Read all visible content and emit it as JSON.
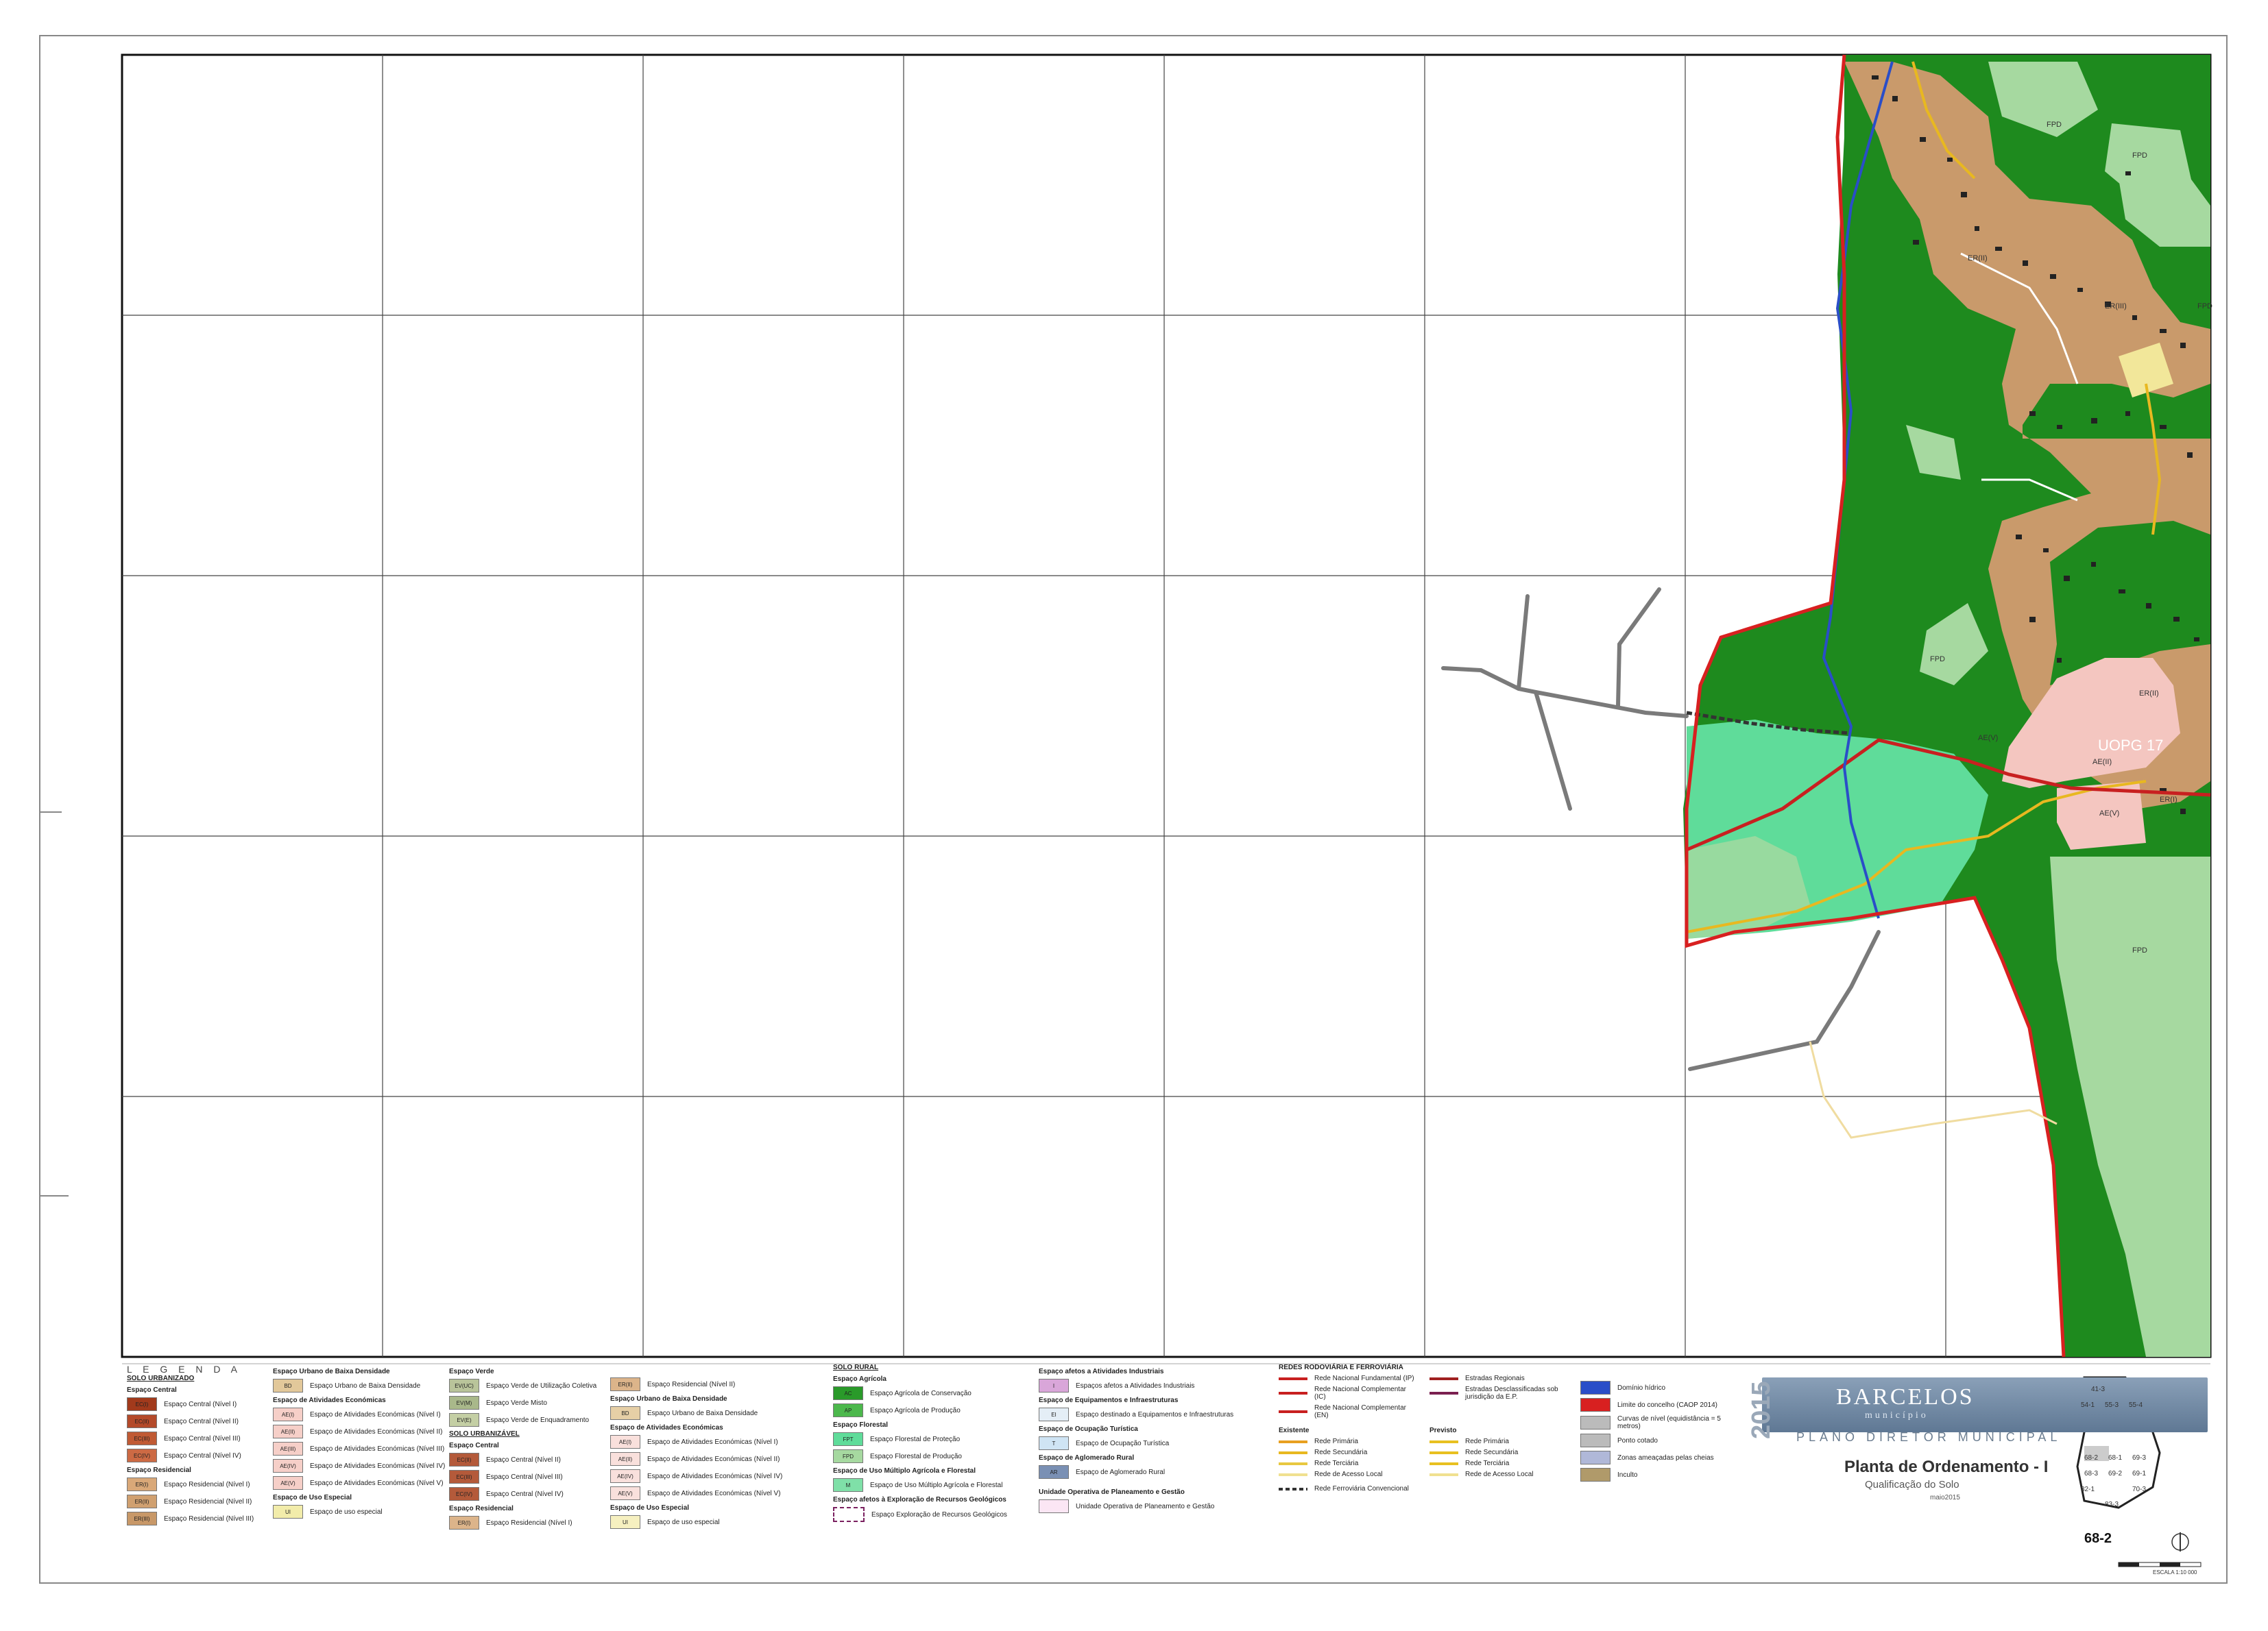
{
  "title_block": {
    "municipality": "BARCELOS",
    "municipality_sub": "município",
    "year": "2015",
    "plan": "PLANO DIRETOR MUNICIPAL",
    "map_title": "Planta de Ordenamento - I",
    "map_subtitle": "Qualificação do Solo",
    "date": "maio2015",
    "sheet": "68-2",
    "scale": "ESCALA 1:10 000"
  },
  "key_map": {
    "cells": [
      "41-3",
      "54-1",
      "55-3",
      "55-4",
      "68-2",
      "68-1",
      "68-3",
      "69-2",
      "69-1",
      "69-3",
      "70-3",
      "82-1",
      "83-3"
    ]
  },
  "map": {
    "labels": [
      "FPD",
      "FPD",
      "FPD",
      "FPD",
      "ER(II)",
      "ER(III)",
      "AE(II)",
      "AE(V)",
      "AE(V)",
      "ER(II)",
      "UOPG 17",
      "ER(I)",
      "FPD"
    ],
    "colors": {
      "agri_conservation": "#1e8a1e",
      "forest_protection": "#5fdc9a",
      "forest_production": "#a6d9a0",
      "residential": "#c99a6b",
      "economic": "#f4c6c0",
      "equipment": "#f2e79a",
      "boundary": "#d82020",
      "river": "#2a4ec8",
      "road_gray": "#7a7a7a",
      "road_yellow": "#e8b820"
    }
  },
  "legend": {
    "heading": "L E G E N D A",
    "col1": {
      "title": "SOLO URBANIZADO",
      "g1": "Espaço Central",
      "items1": [
        {
          "code": "EC(I)",
          "label": "Espaço Central (Nível I)",
          "color": "#a23a1c"
        },
        {
          "code": "EC(II)",
          "label": "Espaço Central (Nível II)",
          "color": "#b44a2a"
        },
        {
          "code": "EC(III)",
          "label": "Espaço Central (Nível III)",
          "color": "#c05a34"
        },
        {
          "code": "EC(IV)",
          "label": "Espaço Central (Nível IV)",
          "color": "#cc6a44"
        }
      ],
      "g2": "Espaço Residencial",
      "items2": [
        {
          "code": "ER(I)",
          "label": "Espaço Residencial (Nível I)",
          "color": "#d9a878"
        },
        {
          "code": "ER(II)",
          "label": "Espaço Residencial (Nível II)",
          "color": "#d0a070"
        },
        {
          "code": "ER(III)",
          "label": "Espaço Residencial (Nível III)",
          "color": "#c89868"
        }
      ]
    },
    "col2": {
      "g1": "Espaço Urbano de Baixa Densidade",
      "items1": [
        {
          "code": "BD",
          "label": "Espaço Urbano de Baixa Densidade",
          "color": "#e2c89a"
        }
      ],
      "g2": "Espaço de Atividades Económicas",
      "items2": [
        {
          "code": "AE(I)",
          "label": "Espaço de Atividades Económicas (Nível I)",
          "color": "#f6cfc8"
        },
        {
          "code": "AE(II)",
          "label": "Espaço de Atividades Económicas (Nível II)",
          "color": "#f6cfc8"
        },
        {
          "code": "AE(III)",
          "label": "Espaço de Atividades Económicas (Nível III)",
          "color": "#f6cfc8"
        },
        {
          "code": "AE(IV)",
          "label": "Espaço de Atividades Económicas (Nível IV)",
          "color": "#f6cfc8"
        },
        {
          "code": "AE(V)",
          "label": "Espaço de Atividades Económicas (Nível V)",
          "color": "#f6cfc8"
        }
      ],
      "g3": "Espaço de Uso Especial",
      "items3": [
        {
          "code": "UI",
          "label": "Espaço de uso especial",
          "color": "#f2ecaa"
        }
      ]
    },
    "col3": {
      "g1": "Espaço Verde",
      "items1": [
        {
          "code": "EV(UC)",
          "label": "Espaço Verde de Utilização Coletiva",
          "color": "#b9c49a"
        },
        {
          "code": "EV(M)",
          "label": "Espaço Verde Misto",
          "color": "#a9b88a"
        },
        {
          "code": "EV(E)",
          "label": "Espaço Verde de Enquadramento",
          "color": "#c4cfa4"
        }
      ],
      "title2": "SOLO URBANIZÁVEL",
      "g2": "Espaço Central",
      "items2": [
        {
          "code": "EC(II)",
          "label": "Espaço Central (Nível II)",
          "color": "#b45a3a"
        },
        {
          "code": "EC(III)",
          "label": "Espaço Central (Nível III)",
          "color": "#b45a3a"
        },
        {
          "code": "EC(IV)",
          "label": "Espaço Central (Nível IV)",
          "color": "#b45a3a"
        }
      ],
      "g3": "Espaço Residencial",
      "items3": [
        {
          "code": "ER(I)",
          "label": "Espaço Residencial (Nível I)",
          "color": "#dcb48a"
        }
      ]
    },
    "col4": {
      "items1": [
        {
          "code": "ER(II)",
          "label": "Espaço Residencial (Nível II)",
          "color": "#dcb48a"
        }
      ],
      "g2": "Espaço Urbano de Baixa Densidade",
      "items2": [
        {
          "code": "BD",
          "label": "Espaço Urbano de Baixa Densidade",
          "color": "#e6cfa6"
        }
      ],
      "g3": "Espaço de Atividades Económicas",
      "items3": [
        {
          "code": "AE(I)",
          "label": "Espaço de Atividades Económicas (Nível I)",
          "color": "#f9e0dc"
        },
        {
          "code": "AE(II)",
          "label": "Espaço de Atividades Económicas (Nível II)",
          "color": "#f9e0dc"
        },
        {
          "code": "AE(IV)",
          "label": "Espaço de Atividades Económicas (Nível IV)",
          "color": "#f9e0dc"
        },
        {
          "code": "AE(V)",
          "label": "Espaço de Atividades Económicas (Nível V)",
          "color": "#f9e0dc"
        }
      ],
      "g4": "Espaço de Uso Especial",
      "items4": [
        {
          "code": "UI",
          "label": "Espaço de uso especial",
          "color": "#f6f0c0"
        }
      ]
    },
    "col5": {
      "title": "SOLO RURAL",
      "g1": "Espaço Agrícola",
      "items1": [
        {
          "code": "AC",
          "label": "Espaço Agrícola de Conservação",
          "color": "#2a9a2a"
        },
        {
          "code": "AP",
          "label": "Espaço Agrícola de Produção",
          "color": "#4cb84c"
        }
      ],
      "g2": "Espaço Florestal",
      "items2": [
        {
          "code": "FPT",
          "label": "Espaço Florestal de Proteção",
          "color": "#5fdc9a"
        },
        {
          "code": "FPD",
          "label": "Espaço Florestal de Produção",
          "color": "#a6d9a0"
        }
      ],
      "g3": "Espaço de Uso Múltiplo Agrícola e Florestal",
      "items3": [
        {
          "code": "M",
          "label": "Espaço de Uso Múltiplo Agrícola e Florestal",
          "color": "#7fe0a8"
        }
      ],
      "g4": "Espaço afetos à Exploração de Recursos Geológicos",
      "items4": [
        {
          "code": "",
          "label": "Espaço Exploração de Recursos Geológicos",
          "color": "#ffffff"
        }
      ]
    },
    "col6": {
      "g1": "Espaço afetos a Atividades Industriais",
      "items1": [
        {
          "code": "I",
          "label": "Espaços afetos a Atividades Industriais",
          "color": "#d9a6d9"
        }
      ],
      "g2": "Espaço de Equipamentos e Infraestruturas",
      "items2": [
        {
          "code": "EI",
          "label": "Espaço destinado a Equipamentos e Infraestruturas",
          "color": "#e4eef6"
        }
      ],
      "g3": "Espaço de Ocupação Turística",
      "items3": [
        {
          "code": "T",
          "label": "Espaço de Ocupação Turística",
          "color": "#cfe4f4"
        }
      ],
      "g4": "Espaço de Aglomerado Rural",
      "items4": [
        {
          "code": "AR",
          "label": "Espaço de Aglomerado Rural",
          "color": "#7a90b4"
        }
      ],
      "g5": "Unidade Operativa de Planeamento e Gestão",
      "items5": [
        {
          "code": "",
          "label": "Unidade Operativa de Planeamento e Gestão",
          "color": "#fbe6f4"
        }
      ]
    },
    "col7": {
      "title": "REDES RODOVIÁRIA E FERROVIÁRIA",
      "items1": [
        {
          "label": "Rede Nacional Fundamental (IP)",
          "color": "#c82020"
        },
        {
          "label": "Rede Nacional Complementar (IC)",
          "color": "#c82020"
        },
        {
          "label": "Rede Nacional Complementar (EN)",
          "color": "#c82020"
        }
      ],
      "items2": [
        {
          "label": "Estradas Regionais",
          "color": "#a02020"
        },
        {
          "label": "Estradas Desclassificadas sob jurisdição da E.P.",
          "color": "#7a2050"
        }
      ],
      "existing": "Existente",
      "planned": "Previsto",
      "items3": [
        {
          "label": "Rede Primária",
          "color": "#e8a020"
        },
        {
          "label": "Rede Secundária",
          "color": "#e8b820"
        },
        {
          "label": "Rede Terciária",
          "color": "#e8c840"
        },
        {
          "label": "Rede de Acesso Local",
          "color": "#f0e090"
        }
      ],
      "items4": [
        {
          "label": "Rede Primária",
          "color": "#e8c020"
        },
        {
          "label": "Rede Secundária",
          "color": "#e8c020"
        },
        {
          "label": "Rede Terciária",
          "color": "#e8c020"
        },
        {
          "label": "Rede de Acesso Local",
          "color": "#f0e090"
        }
      ],
      "rail": "Rede Ferroviária Convencional"
    },
    "col8": {
      "items": [
        {
          "label": "Domínio hídrico",
          "color": "#2a4ec8"
        },
        {
          "label": "Limite do concelho (CAOP 2014)",
          "color": "#d82020"
        },
        {
          "label": "Curvas de nível (equidistância = 5 metros)",
          "color": "#bbbbbb"
        },
        {
          "label": "Ponto cotado",
          "color": "#bbbbbb"
        },
        {
          "label": "Zonas ameaçadas pelas cheias",
          "color": "#b0b8d8"
        },
        {
          "label": "Inculto",
          "color": "#b09a6a"
        }
      ]
    }
  }
}
